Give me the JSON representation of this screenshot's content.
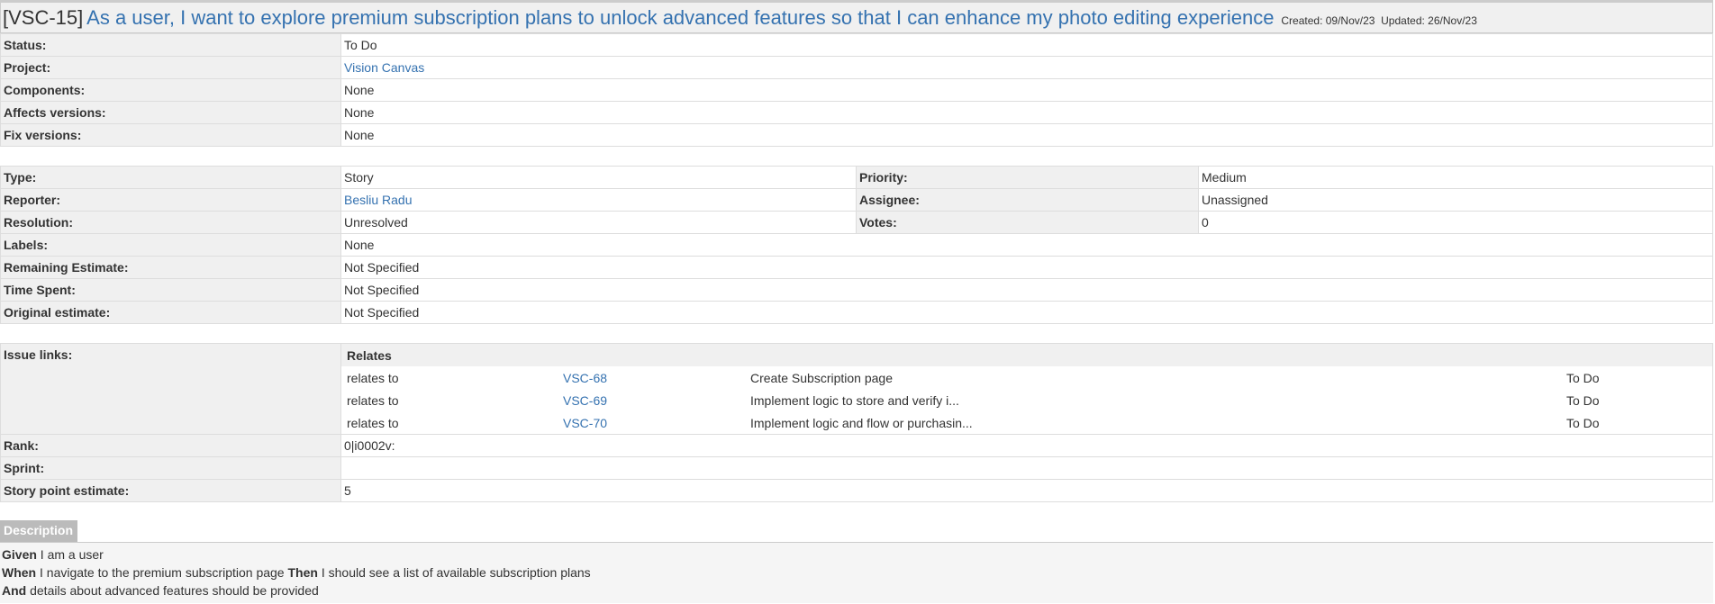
{
  "header": {
    "key": "[VSC-15]",
    "title": "As a user, I want to explore premium subscription plans to unlock advanced features so that I can enhance my photo editing experience",
    "created_label": "Created:",
    "created": "09/Nov/23",
    "updated_label": "Updated:",
    "updated": "26/Nov/23"
  },
  "fields1": {
    "status": {
      "label": "Status:",
      "value": "To Do"
    },
    "project": {
      "label": "Project:",
      "value": "Vision Canvas"
    },
    "components": {
      "label": "Components:",
      "value": "None"
    },
    "affects_versions": {
      "label": "Affects versions:",
      "value": "None"
    },
    "fix_versions": {
      "label": "Fix versions:",
      "value": "None"
    }
  },
  "fields2": {
    "type": {
      "label": "Type:",
      "value": "Story"
    },
    "priority": {
      "label": "Priority:",
      "value": "Medium"
    },
    "reporter": {
      "label": "Reporter:",
      "value": "Besliu Radu"
    },
    "assignee": {
      "label": "Assignee:",
      "value": "Unassigned"
    },
    "resolution": {
      "label": "Resolution:",
      "value": "Unresolved"
    },
    "votes": {
      "label": "Votes:",
      "value": "0"
    },
    "labels": {
      "label": "Labels:",
      "value": "None"
    },
    "remaining_estimate": {
      "label": "Remaining Estimate:",
      "value": "Not Specified"
    },
    "time_spent": {
      "label": "Time Spent:",
      "value": "Not Specified"
    },
    "original_estimate": {
      "label": "Original estimate:",
      "value": "Not Specified"
    }
  },
  "issue_links": {
    "label": "Issue links:",
    "group": "Relates",
    "links": [
      {
        "relation": "relates to",
        "key": "VSC-68",
        "summary": "Create Subscription page",
        "status": "To Do"
      },
      {
        "relation": "relates to",
        "key": "VSC-69",
        "summary": "Implement logic to store and verify i...",
        "status": "To Do"
      },
      {
        "relation": "relates to",
        "key": "VSC-70",
        "summary": "Implement logic and flow or purchasin...",
        "status": "To Do"
      }
    ]
  },
  "fields3": {
    "rank": {
      "label": "Rank:",
      "value": "0|i0002v:"
    },
    "sprint": {
      "label": "Sprint:",
      "value": ""
    },
    "story_points": {
      "label": "Story point estimate:",
      "value": "5"
    }
  },
  "description": {
    "tab": "Description",
    "lines": [
      {
        "kw": "Given",
        "text": " I am a user"
      },
      {
        "kw": "When",
        "text": " I navigate to the premium subscription page ",
        "kw2": "Then",
        "text2": " I should see a list of available subscription plans"
      },
      {
        "kw": "And",
        "text": " details about advanced features should be provided"
      }
    ]
  },
  "colors": {
    "link": "#3572b0",
    "label_bg": "#f0f0f0",
    "desc_tab_bg": "#bbbbbb"
  }
}
